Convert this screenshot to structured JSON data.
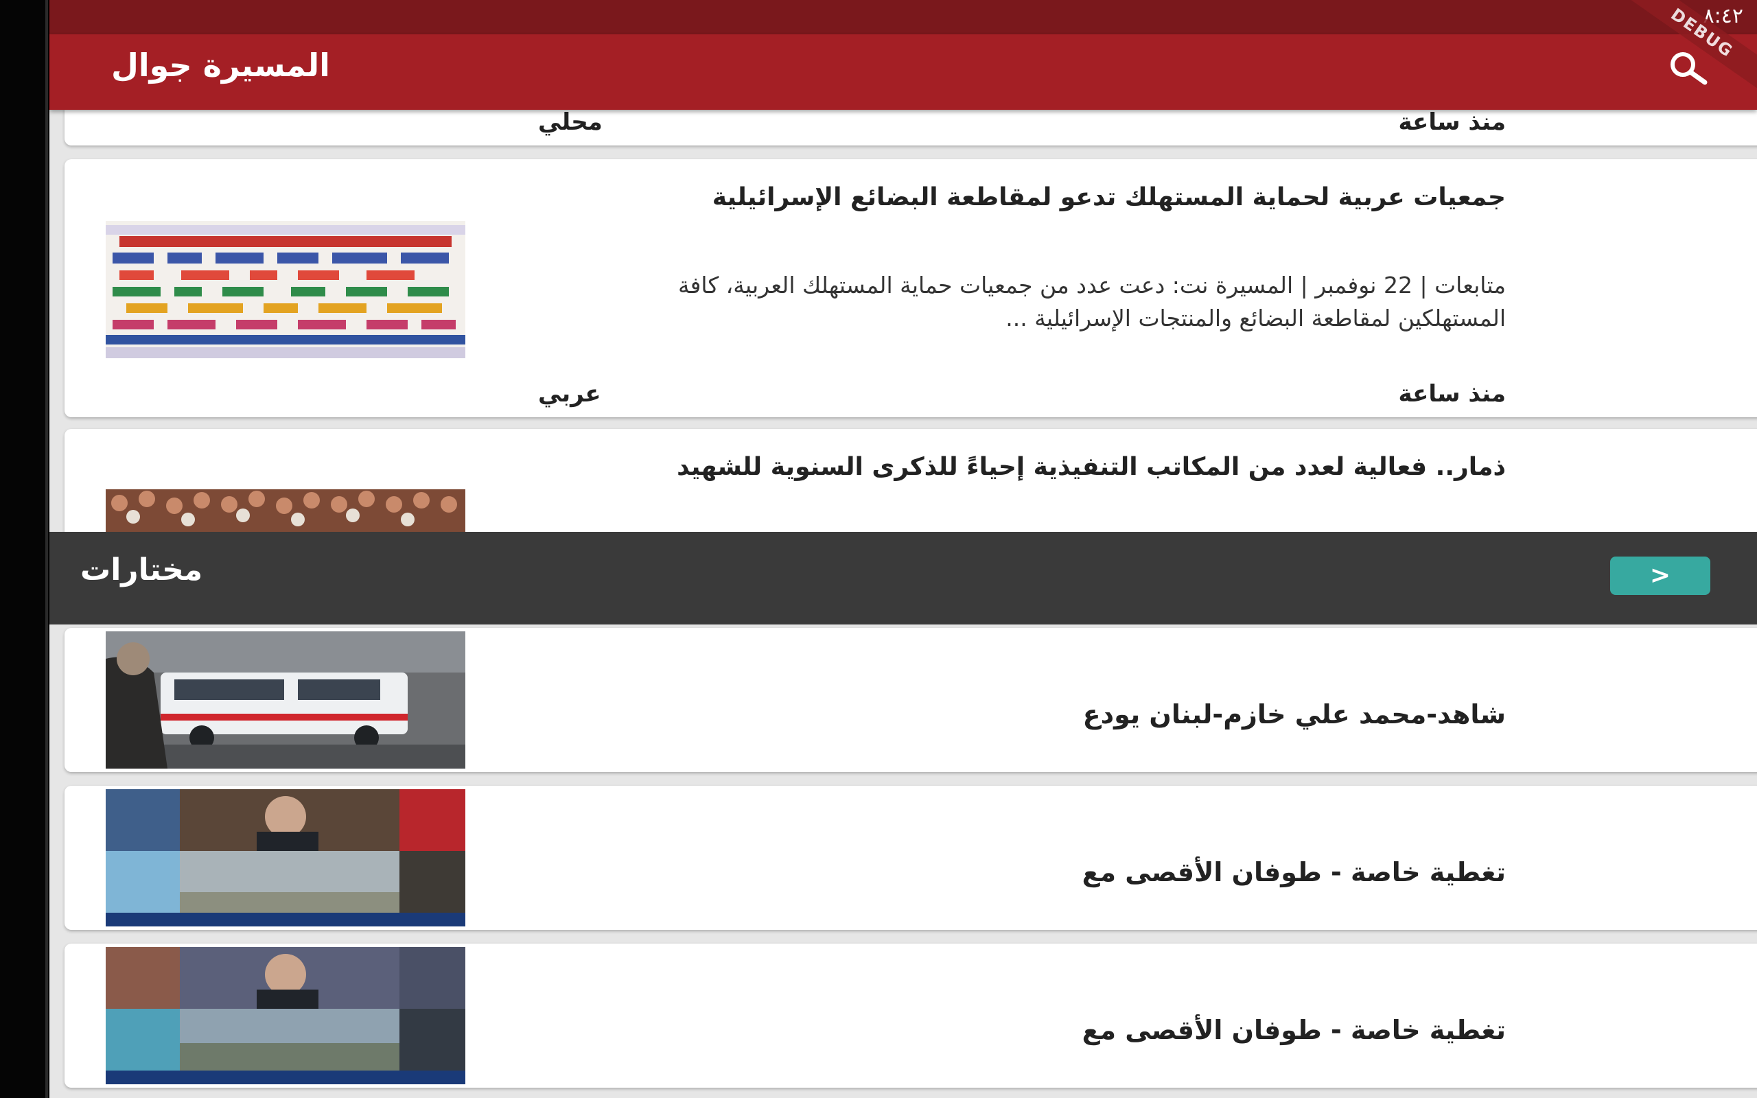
{
  "status": {
    "time": "٨:٤٢"
  },
  "debug_label": "DEBUG",
  "app_bar": {
    "title": "المسيرة جوال"
  },
  "news_list": [
    {
      "time": "منذ ساعة",
      "category": "محلي"
    },
    {
      "title": "جمعيات عربية لحماية المستهلك تدعو لمقاطعة البضائع الإسرائيلية",
      "excerpt": "متابعات | 22 نوفمبر | المسيرة نت: دعت عدد من جمعيات حماية المستهلك العربية، كافة المستهلكين لمقاطعة البضائع والمنتجات الإسرائيلية ...",
      "time": "منذ ساعة",
      "category": "عربي"
    },
    {
      "title": "ذمار.. فعالية لعدد من المكاتب التنفيذية إحياءً للذكرى السنوية للشهيد"
    }
  ],
  "section": {
    "title": "مختارات",
    "more_label": ">"
  },
  "videos": [
    {
      "title": "شاهد-محمد علي خازم-لبنان يودع"
    },
    {
      "title": "تغطية خاصة - طوفان الأقصى مع"
    },
    {
      "title": "تغطية خاصة - طوفان الأقصى مع"
    }
  ],
  "colors": {
    "status_bar": "#7a181c",
    "app_bar": "#a41f25",
    "section_bar": "#3a3a3a",
    "accent_button": "#37a9a0"
  },
  "icons": {
    "search": "search-icon",
    "more": "chevron-right-icon"
  }
}
